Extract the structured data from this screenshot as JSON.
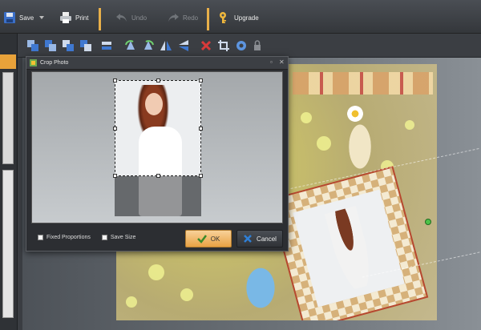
{
  "toolbar": {
    "save_label": "Save",
    "print_label": "Print",
    "undo_label": "Undo",
    "redo_label": "Redo",
    "upgrade_label": "Upgrade"
  },
  "dialog": {
    "title": "Crop Photo",
    "fixed_proportions_label": "Fixed Proportions",
    "save_size_label": "Save Size",
    "ok_label": "OK",
    "cancel_label": "Cancel"
  },
  "colors": {
    "accent_orange": "#e8a23a",
    "ok_button": "#e8a244",
    "cancel_icon": "#2f7fd6",
    "delete_icon": "#d83a3a"
  },
  "icons": {
    "save": "floppy-icon",
    "print": "printer-icon",
    "undo": "undo-arrow-icon",
    "redo": "redo-arrow-icon",
    "upgrade": "key-icon",
    "ok": "checkmark-icon",
    "cancel": "x-icon"
  }
}
